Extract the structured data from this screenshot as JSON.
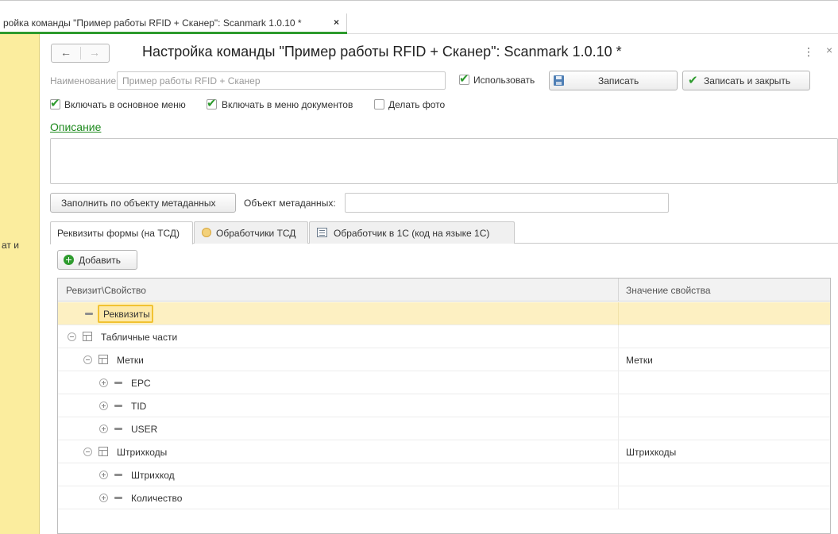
{
  "window": {
    "tab_title": "ройка команды \"Пример работы RFID + Сканер\": Scanmark 1.0.10 *",
    "tab_close": "×"
  },
  "left_panel": {
    "text": "ат и"
  },
  "form": {
    "title": "Настройка команды \"Пример работы RFID + Сканер\": Scanmark 1.0.10 *",
    "more_icon": "⋮",
    "close_icon": "×",
    "name_label": "Наименование:",
    "name_value": "Пример работы RFID + Сканер",
    "use_label": "Использовать",
    "use_checked": true,
    "save_label": "Записать",
    "save_close_label": "Записать и закрыть",
    "include_main_menu_label": "Включать в основное меню",
    "include_main_menu_checked": true,
    "include_docs_menu_label": "Включать в меню документов",
    "include_docs_menu_checked": true,
    "make_photo_label": "Делать фото",
    "make_photo_checked": false,
    "description_link": "Описание",
    "description_value": "",
    "fill_button_label": "Заполнить по объекту метаданных",
    "metadata_label": "Объект метаданных:",
    "metadata_value": ""
  },
  "tabs": [
    {
      "label": "Реквизиты формы (на ТСД)",
      "active": true
    },
    {
      "label": "Обработчики ТСД",
      "icon": "handler-circle-icon"
    },
    {
      "label": "Обработчик в 1С  (код на языке 1С)",
      "icon": "code-module-icon"
    }
  ],
  "add_button_label": "Добавить",
  "table": {
    "col1": "Ревизит\\Свойство",
    "col2": "Значение свойства",
    "rows": [
      {
        "name": "Реквизиты",
        "value": ""
      },
      {
        "name": "Табличные части",
        "value": ""
      },
      {
        "name": "Метки",
        "value": "Метки"
      },
      {
        "name": "EPC",
        "value": ""
      },
      {
        "name": "TID",
        "value": ""
      },
      {
        "name": "USER",
        "value": ""
      },
      {
        "name": "Штрихкоды",
        "value": "Штрихкоды"
      },
      {
        "name": "Штрихкод",
        "value": ""
      },
      {
        "name": "Количество",
        "value": ""
      }
    ]
  },
  "colors": {
    "accent_green": "#2e9b2e",
    "left_panel": "#fbed9e",
    "selected_row": "#fdf0c2"
  }
}
